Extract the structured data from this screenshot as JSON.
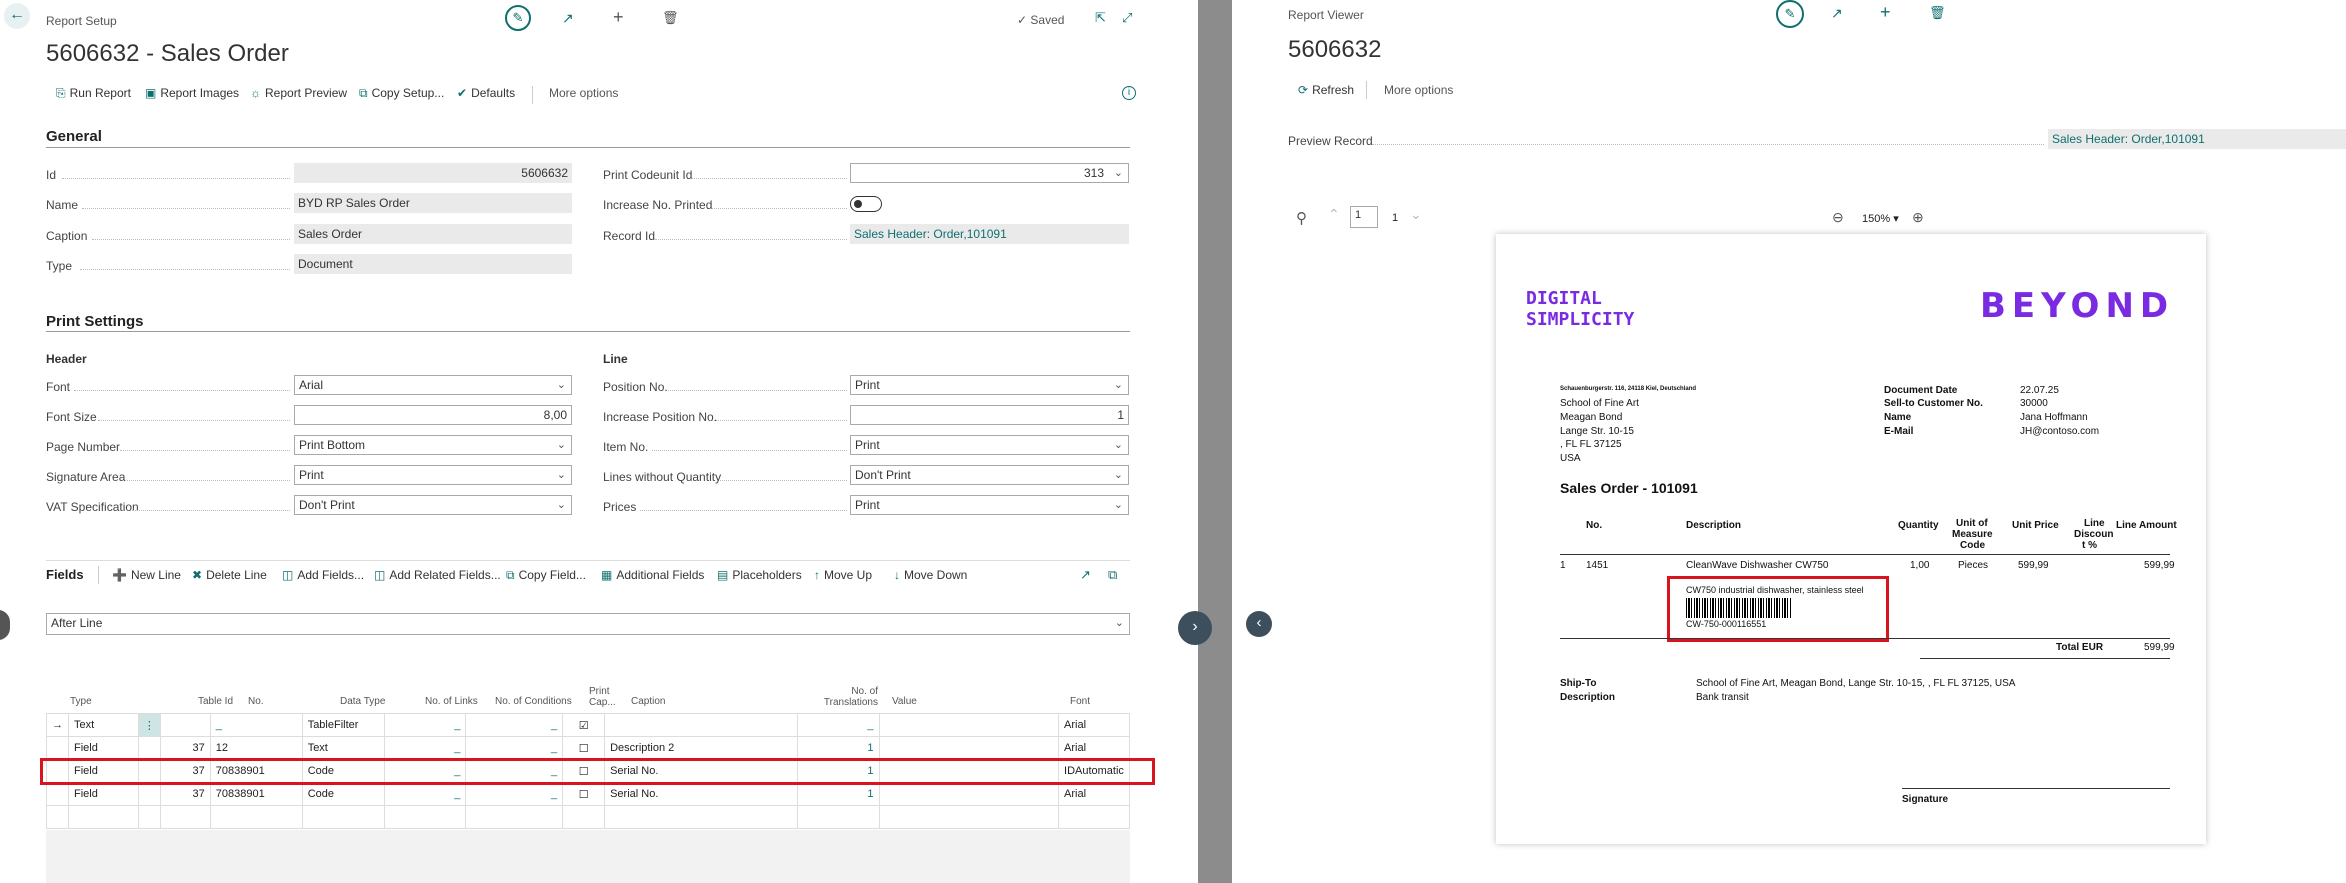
{
  "left": {
    "breadcrumb": "Report Setup",
    "title": "5606632 - Sales Order",
    "saved": "Saved",
    "toolbar": [
      "Run Report",
      "Report Images",
      "Report Preview",
      "Copy Setup...",
      "Defaults",
      "More options"
    ],
    "general": {
      "heading": "General",
      "id_label": "Id",
      "id_value": "5606632",
      "name_label": "Name",
      "name_value": "BYD RP Sales Order",
      "caption_label": "Caption",
      "caption_value": "Sales Order",
      "type_label": "Type",
      "type_value": "Document",
      "print_codeunit_label": "Print Codeunit Id",
      "print_codeunit_value": "313",
      "increase_label": "Increase No. Printed",
      "record_label": "Record Id",
      "record_value": "Sales Header: Order,101091"
    },
    "print_settings": {
      "heading": "Print Settings",
      "header_group": "Header",
      "line_group": "Line",
      "font_label": "Font",
      "font_value": "Arial",
      "font_size_label": "Font Size",
      "font_size_value": "8,00",
      "page_number_label": "Page Number",
      "page_number_value": "Print Bottom",
      "signature_label": "Signature Area",
      "signature_value": "Print",
      "vat_label": "VAT Specification",
      "vat_value": "Don't Print",
      "position_label": "Position No.",
      "position_value": "Print",
      "inc_pos_label": "Increase Position No.",
      "inc_pos_value": "1",
      "item_no_label": "Item No.",
      "item_no_value": "Print",
      "lines_wo_qty_label": "Lines without Quantity",
      "lines_wo_qty_value": "Don't Print",
      "prices_label": "Prices",
      "prices_value": "Print"
    },
    "fields": {
      "heading": "Fields",
      "actions": [
        "New Line",
        "Delete Line",
        "Add Fields...",
        "Add Related Fields...",
        "Copy Field...",
        "Additional Fields",
        "Placeholders",
        "Move Up",
        "Move Down"
      ],
      "position_value": "After Line",
      "columns": {
        "type": "Type",
        "table_id": "Table Id",
        "no": "No.",
        "data_type": "Data Type",
        "no_links": "No. of Links",
        "no_conditions": "No. of Conditions",
        "print_cap": "Print Cap...",
        "caption": "Caption",
        "no_translations": "No. of Translations",
        "value": "Value",
        "font": "Font"
      },
      "rows": [
        {
          "type": "Text",
          "table_id": "",
          "no": "_",
          "data_type": "TableFilter",
          "links": "_",
          "conditions": "_",
          "checked": true,
          "caption": "",
          "translations": "_",
          "value": "",
          "font": "Arial"
        },
        {
          "type": "Field",
          "table_id": "37",
          "no": "12",
          "data_type": "Text",
          "links": "_",
          "conditions": "_",
          "checked": false,
          "caption": "Description 2",
          "translations": "1",
          "value": "",
          "font": "Arial"
        },
        {
          "type": "Field",
          "table_id": "37",
          "no": "70838901",
          "data_type": "Code",
          "links": "_",
          "conditions": "_",
          "checked": false,
          "caption": "Serial No.",
          "translations": "1",
          "value": "",
          "font": "IDAutomatic"
        },
        {
          "type": "Field",
          "table_id": "37",
          "no": "70838901",
          "data_type": "Code",
          "links": "_",
          "conditions": "_",
          "checked": false,
          "caption": "Serial No.",
          "translations": "1",
          "value": "",
          "font": "Arial"
        }
      ]
    }
  },
  "right": {
    "breadcrumb": "Report Viewer",
    "title": "5606632",
    "refresh": "Refresh",
    "more": "More options",
    "preview_label": "Preview Record",
    "preview_value": "Sales Header: Order,101091",
    "page_current": "1",
    "page_total": "1",
    "zoom": "150%",
    "report": {
      "logo_left_1": "DIGITAL",
      "logo_left_2": "SIMPLICITY",
      "logo_right": "BEYOND",
      "sender": "Schauenburgerstr. 116, 24118 Kiel, Deutschland",
      "addr": [
        "School of Fine Art",
        "Meagan Bond",
        "Lange Str. 10-15",
        ", FL FL 37125",
        "USA"
      ],
      "doc_date_label": "Document Date",
      "doc_date": "22.07.25",
      "sell_label": "Sell-to Customer No.",
      "sell": "30000",
      "name_label": "Name",
      "name": "Jana Hoffmann",
      "email_label": "E-Mail",
      "email": "JH@contoso.com",
      "heading": "Sales Order - 101091",
      "col_no": "No.",
      "col_desc": "Description",
      "col_qty": "Quantity",
      "col_uom_1": "Unit of",
      "col_uom_2": "Measure",
      "col_uom_3": "Code",
      "col_price": "Unit Price",
      "col_disc_1": "Line",
      "col_disc_2": "Discoun",
      "col_disc_3": "t %",
      "col_amount": "Line Amount",
      "line_pos": "1",
      "line_no": "1451",
      "line_desc": "CleanWave Dishwasher CW750",
      "line_qty": "1,00",
      "line_uom": "Pieces",
      "line_price": "599,99",
      "line_amount": "599,99",
      "line_desc2": "CW750 industrial dishwasher, stainless steel",
      "serial": "CW-750-000116551",
      "total_label": "Total EUR",
      "total": "599,99",
      "shipto_label": "Ship-To",
      "shipto": "School of Fine Art, Meagan Bond, Lange Str. 10-15, , FL FL 37125, USA",
      "desc_label": "Description",
      "desc": "Bank transit",
      "signature": "Signature"
    }
  },
  "colors": {
    "accent": "#0f6f6f",
    "highlight": "#d9141e",
    "logo": "#7a2be2"
  }
}
